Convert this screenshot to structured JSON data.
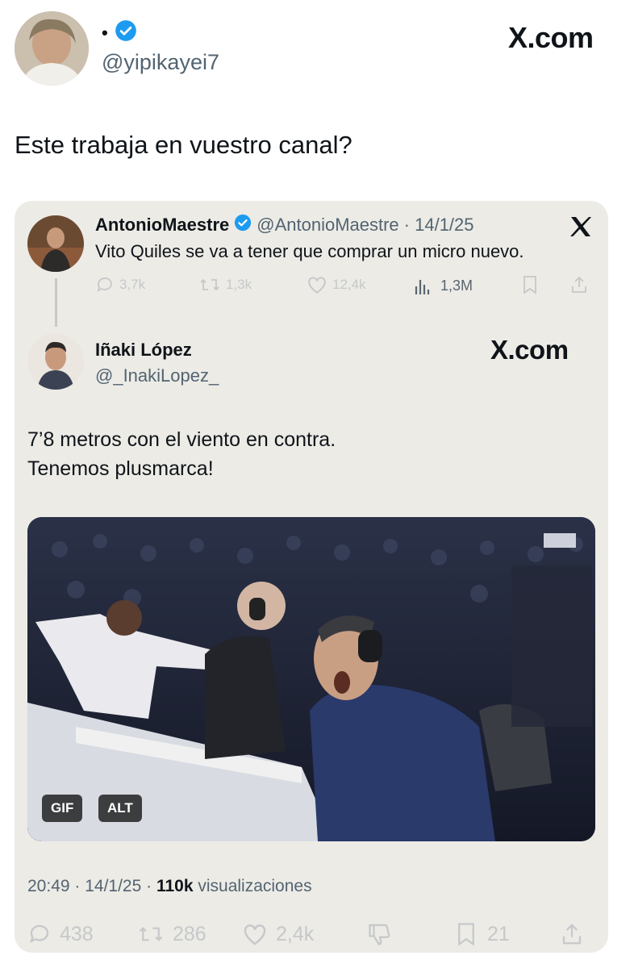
{
  "tweet": {
    "display_name": "•",
    "handle": "@yipikayei7",
    "text": "Este trabaja en vuestro canal?",
    "site": "X.com"
  },
  "quoted_parent": {
    "name": "AntonioMaestre",
    "handle": "@AntonioMaestre",
    "date": "· 14/1/25",
    "text": "Vito Quiles se va a tener que comprar un micro nuevo.",
    "stats": {
      "replies": "3,7k",
      "reposts": "1,3k",
      "likes": "12,4k",
      "views": "1,3M"
    }
  },
  "quoted": {
    "name": "Iñaki López",
    "handle": "@_InakiLopez_",
    "site": "X.com",
    "text_line1": "7’8 metros con el viento en contra.",
    "text_line2": "Tenemos plusmarca!",
    "media_badges": {
      "gif": "GIF",
      "alt": "ALT"
    },
    "meta_time": "20:49 · 14/1/25 ·",
    "meta_views_count": "110k",
    "meta_views_label": "visualizaciones",
    "stats": {
      "replies": "438",
      "reposts": "286",
      "likes": "2,4k",
      "bookmarks": "21"
    }
  },
  "colors": {
    "verified": "#1d9bf0",
    "card_bg": "#ecebe6"
  }
}
